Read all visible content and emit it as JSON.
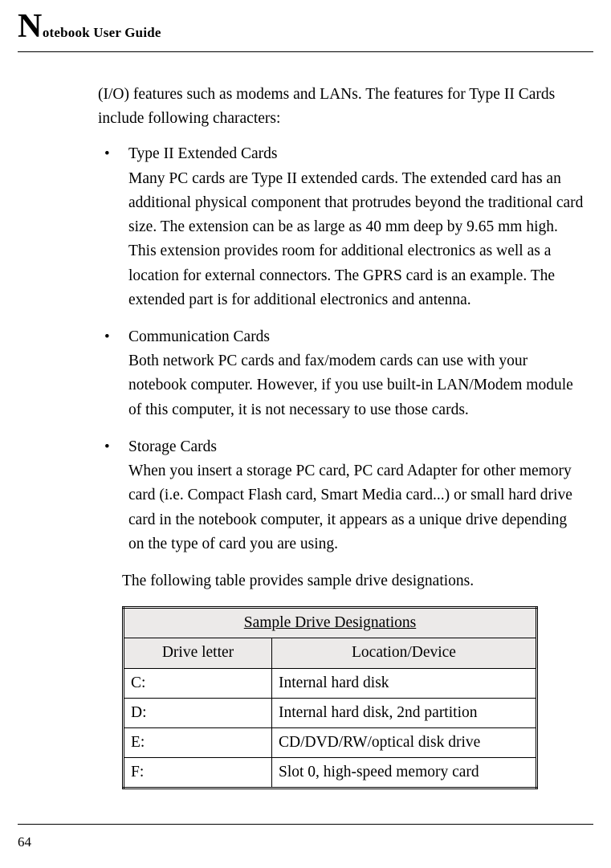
{
  "header": {
    "big_letter": "N",
    "rest": "otebook User Guide"
  },
  "intro": "(I/O) features such as modems and LANs. The features for Type II Cards include following characters:",
  "bullets": [
    {
      "title": "Type II Extended Cards",
      "body": "Many PC cards are Type II extended cards. The extended card has an additional physical component that protrudes beyond the traditional card size. The extension can be as large as 40 mm deep by 9.65 mm high. This extension provides room for additional electronics as well as a location for external connectors. The GPRS card is an example. The extended part is for additional electronics and antenna."
    },
    {
      "title": "Communication Cards",
      "body": "Both network PC cards and fax/modem cards can use with your notebook computer. However, if you use built-in LAN/Modem module of this computer, it is not necessary to use those cards."
    },
    {
      "title": "Storage Cards",
      "body": "When you insert a storage PC card, PC card Adapter for other memory card (i.e. Compact Flash card, Smart Media card...) or small hard drive card in the notebook computer, it appears as a unique drive depending on the type of card you are using."
    }
  ],
  "post_list": "The following table provides sample drive designations.",
  "table": {
    "title": "Sample Drive Designations",
    "col_a": "Drive letter",
    "col_b": "Location/Device",
    "rows": [
      {
        "a": "C:",
        "b": "Internal hard disk"
      },
      {
        "a": "D:",
        "b": "Internal hard disk, 2nd partition"
      },
      {
        "a": "E:",
        "b": "CD/DVD/RW/optical disk drive"
      },
      {
        "a": "F:",
        "b": "Slot 0, high-speed memory card"
      }
    ]
  },
  "page_number": "64"
}
